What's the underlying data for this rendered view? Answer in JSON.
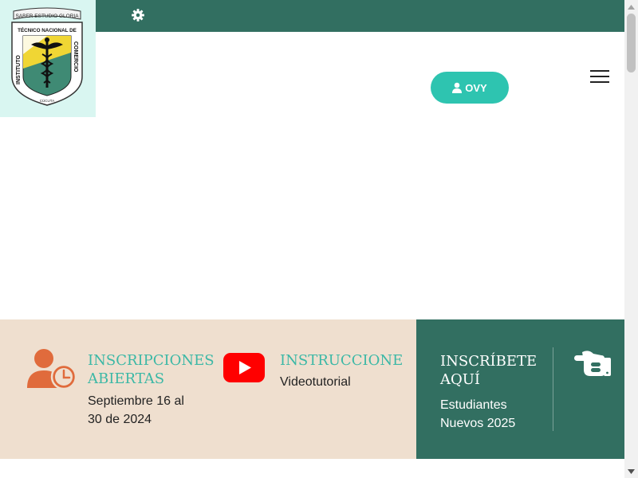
{
  "logo": {
    "motto": "SABER ESTUDIO GLORIA",
    "name_top": "TÉCNICO NACIONAL DE",
    "name_left": "INSTITUTO",
    "name_right": "COMERCIO",
    "city": "CÚCUTA"
  },
  "header": {
    "settings_icon": "gear-icon",
    "user_button_label": "OVY",
    "menu_icon": "hamburger-icon"
  },
  "info": {
    "inscripciones": {
      "title": "INSCRIPCIONES ABIERTAS",
      "dates": "Septiembre 16 al 30 de 2024",
      "icon": "user-clock-icon"
    },
    "instrucciones": {
      "title": "INSTRUCCIONE",
      "subtitle": "Videotutorial",
      "icon": "youtube-icon"
    }
  },
  "cta": {
    "title": "INSCRÍBETE AQUÍ",
    "subtitle": "Estudiantes Nuevos 2025",
    "icon": "hand-pointer-icon"
  },
  "colors": {
    "brand_green": "#326f61",
    "accent_teal": "#2ec4b0",
    "heading_teal": "#3cb8a6",
    "beige": "#efdfcf",
    "icon_orange": "#e06b3c",
    "youtube_red": "#ff0000"
  }
}
